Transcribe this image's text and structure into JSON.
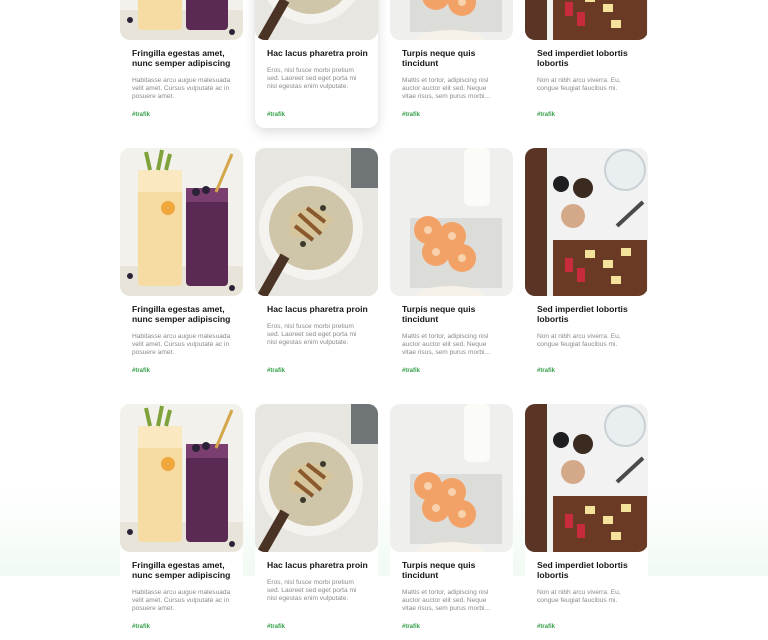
{
  "brand_color": "#36a04a",
  "cards": [
    {
      "title": "Fringilla egestas amet, nunc semper adipiscing",
      "desc": "Habitasse arcu augue malesuada velit amet. Cursus vulputate ac in posuere amet.",
      "tag": "#trafik",
      "image": "smoothie-glasses"
    },
    {
      "title": "Hac lacus pharetra proin",
      "desc": "Eros, nisl fusce morbi pretium sed. Laoreet sed eget porta mi nisl egestas enim vulputate.",
      "tag": "#trafik",
      "image": "pasta-bowl"
    },
    {
      "title": "Turpis neque quis tincidunt",
      "desc": "Mattis et tortor, adipiscing nisl auctor auctor elit sed. Neque vitae risus, sem purus morbi ornare.",
      "tag": "#trafik",
      "image": "waffle-cookies-milk"
    },
    {
      "title": "Sed imperdiet lobortis lobortis",
      "desc": "Non at nibh arcu viverra. Eu, congue feugiat faucibus mi.",
      "tag": "#trafik",
      "image": "snack-board"
    },
    {
      "title": "Fringilla egestas amet, nunc semper adipiscing",
      "desc": "Habitasse arcu augue malesuada velit amet. Cursus vulputate ac in posuere amet.",
      "tag": "#trafik",
      "image": "smoothie-glasses"
    },
    {
      "title": "Hac lacus pharetra proin",
      "desc": "Eros, nisl fusce morbi pretium sed. Laoreet sed eget porta mi nisl egestas enim vulputate.",
      "tag": "#trafik",
      "image": "pasta-bowl"
    },
    {
      "title": "Turpis neque quis tincidunt",
      "desc": "Mattis et tortor, adipiscing nisl auctor auctor elit sed. Neque vitae risus, sem purus morbi ornare.",
      "tag": "#trafik",
      "image": "waffle-cookies-milk"
    },
    {
      "title": "Sed imperdiet lobortis lobortis",
      "desc": "Non at nibh arcu viverra. Eu, congue feugiat faucibus mi.",
      "tag": "#trafik",
      "image": "snack-board"
    },
    {
      "title": "Fringilla egestas amet, nunc semper adipiscing",
      "desc": "Habitasse arcu augue malesuada velit amet. Cursus vulputate ac in posuere amet.",
      "tag": "#trafik",
      "image": "smoothie-glasses"
    },
    {
      "title": "Hac lacus pharetra proin",
      "desc": "Eros, nisl fusce morbi pretium sed. Laoreet sed eget porta mi nisl egestas enim vulputate.",
      "tag": "#trafik",
      "image": "pasta-bowl"
    },
    {
      "title": "Turpis neque quis tincidunt",
      "desc": "Mattis et tortor, adipiscing nisl auctor auctor elit sed. Neque vitae risus, sem purus morbi ornare.",
      "tag": "#trafik",
      "image": "waffle-cookies-milk"
    },
    {
      "title": "Sed imperdiet lobortis lobortis",
      "desc": "Non at nibh arcu viverra. Eu, congue feugiat faucibus mi.",
      "tag": "#trafik",
      "image": "snack-board"
    }
  ]
}
